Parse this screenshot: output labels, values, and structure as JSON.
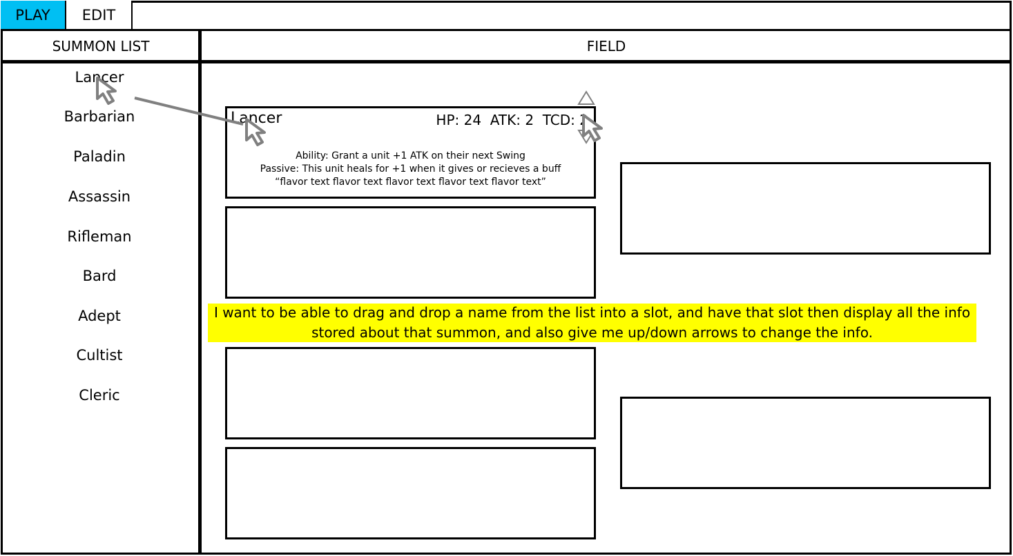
{
  "tabs": {
    "play": "PLAY",
    "edit": "EDIT"
  },
  "headers": {
    "summon_list": "SUMMON LIST",
    "field": "FIELD"
  },
  "summons": [
    "Lancer",
    "Barbarian",
    "Paladin",
    "Assassin",
    "Rifleman",
    "Bard",
    "Adept",
    "Cultist",
    "Cleric"
  ],
  "card": {
    "name": "Lancer",
    "stats": "HP: 24  ATK: 2  TCD: 2",
    "ability": "Ability: Grant a unit +1 ATK on their next Swing",
    "passive": "Passive: This unit heals for +1 when it gives or recieves a buff",
    "flavor": "“flavor text flavor text flavor text flavor text flavor text”"
  },
  "note": "I want to be able to drag and drop a name from the list into a slot, and have that slot then display all the info stored about that summon, and also give me up/down arrows to change the info.",
  "colors": {
    "active_tab": "#00bff3",
    "note_highlight": "#ffff00",
    "border": "#000000",
    "cursor_gray": "#808080"
  },
  "icons": {
    "up": "triangle-up-icon",
    "down": "triangle-down-icon",
    "cursor": "mouse-pointer-icon"
  }
}
